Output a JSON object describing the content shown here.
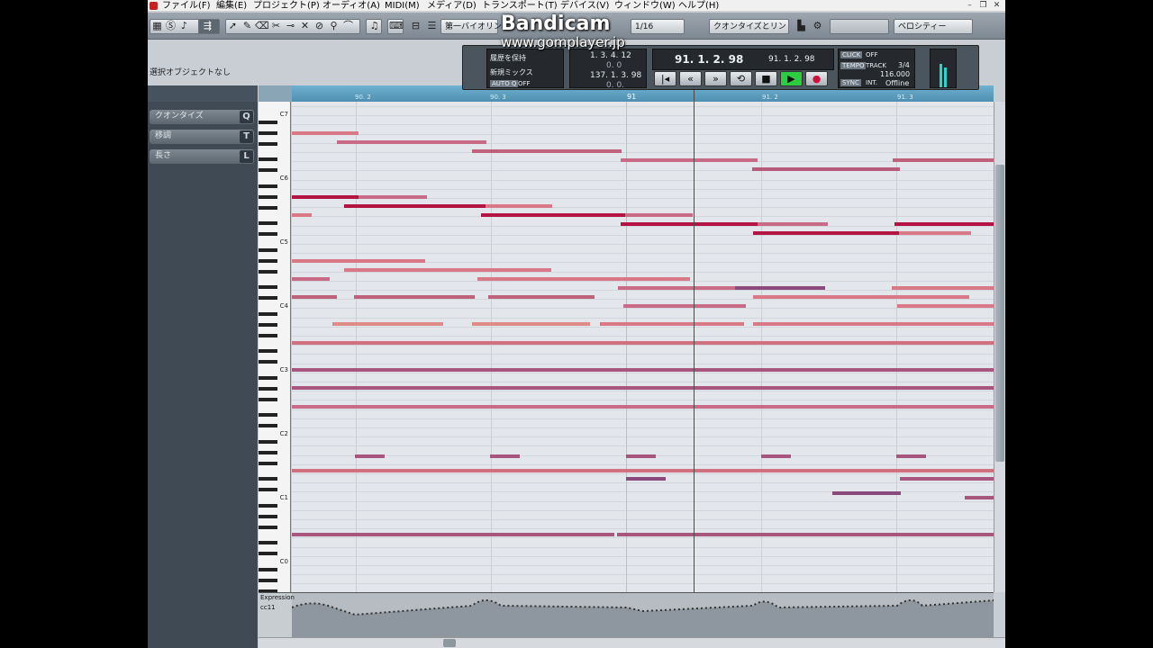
{
  "menu": [
    "ファイル(F)",
    "編集(E)",
    "プロジェクト(P)",
    "オーディオ(A)",
    "MIDI(M)",
    "メディア(D)",
    "トランスポート(T)",
    "デバイス(V)",
    "ウィンドウ(W)",
    "ヘルプ(H)"
  ],
  "toolbar": {
    "track_name": "第一バイオリン",
    "quantize": "1/16",
    "quantize_mode": "クオンタイズとリン",
    "controller": "ベロシティー"
  },
  "info": {
    "no_selection": "選択オブジェクトなし"
  },
  "left_panel": [
    {
      "label": "クオンタイズ",
      "key": "Q"
    },
    {
      "label": "移調",
      "key": "T"
    },
    {
      "label": "長さ",
      "key": "L"
    }
  ],
  "keyboard_labels": [
    "C7",
    "C6",
    "C5",
    "C4",
    "C3",
    "C2",
    "C1",
    "C0"
  ],
  "ruler": [
    "90. 2",
    "90. 3",
    "91",
    "91. 2",
    "91. 3"
  ],
  "controller_lane": {
    "name": "Expression",
    "cc": "cc11"
  },
  "transport": {
    "mode1": "履歴を保持",
    "mode2": "新規ミックス",
    "autoq": "AUTO Q",
    "autoq_val": "OFF",
    "left_locator": "1. 3. 4. 12",
    "left_locator2": "0.  0",
    "right_locator": "137. 1. 3. 98",
    "right_locator2": "0.  0.",
    "position": "91. 1. 2. 98",
    "position2": "91. 1. 2. 98",
    "click": "CLICK",
    "click_val": "OFF",
    "tempo": "TEMPO",
    "track": "TRACK",
    "sig": "3/4",
    "bpm": "116.000",
    "sync": "SYNC",
    "sync_mode": "INT.",
    "sync_state": "Offline"
  },
  "watermark": {
    "title": "Bandicam",
    "url": "www.gomplayer.jp"
  },
  "colors": {
    "accent": "#2ecc40",
    "record": "#d0103a",
    "note_red": "#b41444",
    "note_pink": "#d97988",
    "note_purple": "#8a4a7e"
  }
}
